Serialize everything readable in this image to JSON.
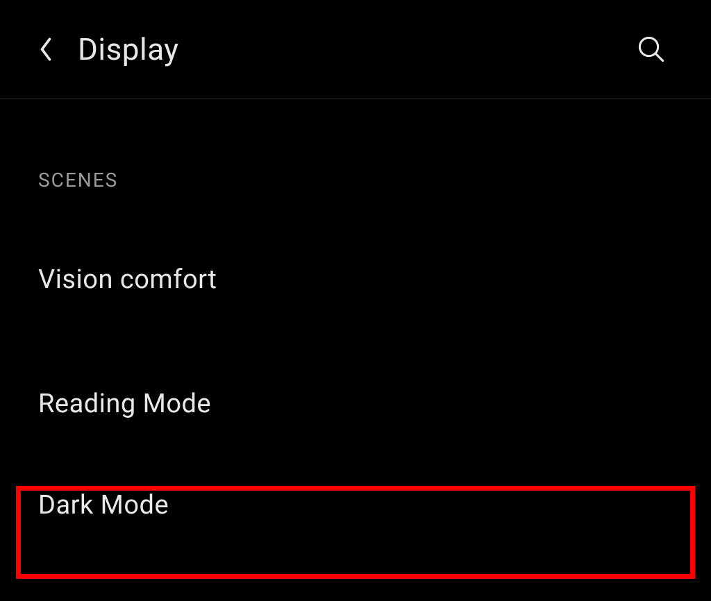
{
  "header": {
    "title": "Display"
  },
  "section": {
    "label": "SCENES",
    "items": [
      "Vision comfort",
      "Reading Mode",
      "Dark Mode"
    ]
  }
}
